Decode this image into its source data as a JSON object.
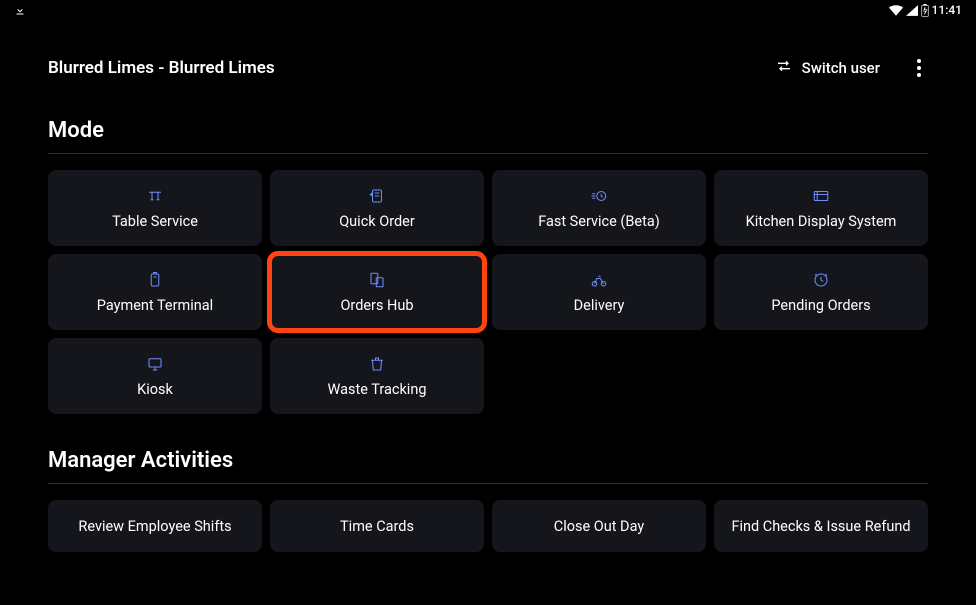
{
  "statusbar": {
    "time": "11:41"
  },
  "header": {
    "title": "Blurred Limes - Blurred Limes",
    "switch_user_label": "Switch user"
  },
  "sections": {
    "mode": {
      "title": "Mode",
      "tiles": [
        {
          "label": "Table Service"
        },
        {
          "label": "Quick Order"
        },
        {
          "label": "Fast Service (Beta)"
        },
        {
          "label": "Kitchen Display System"
        },
        {
          "label": "Payment Terminal"
        },
        {
          "label": "Orders Hub"
        },
        {
          "label": "Delivery"
        },
        {
          "label": "Pending Orders"
        },
        {
          "label": "Kiosk"
        },
        {
          "label": "Waste Tracking"
        }
      ]
    },
    "manager": {
      "title": "Manager Activities",
      "tiles": [
        {
          "label": "Review Employee Shifts"
        },
        {
          "label": "Time Cards"
        },
        {
          "label": "Close Out Day"
        },
        {
          "label": "Find Checks & Issue Refund"
        }
      ]
    }
  }
}
